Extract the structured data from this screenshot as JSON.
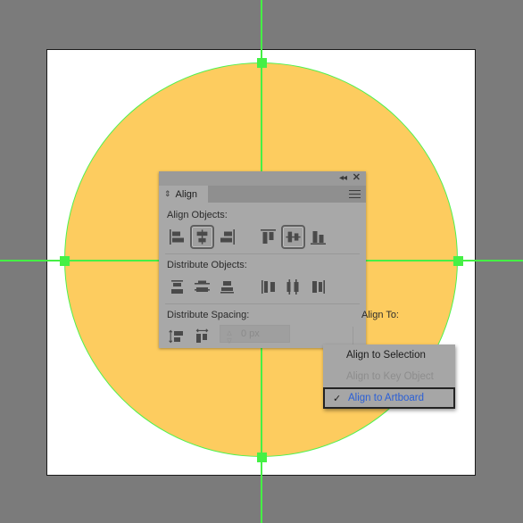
{
  "app": {
    "canvas_background": "#7b7b7b",
    "artboard_background": "#ffffff",
    "shape_fill": "#fdcc5f",
    "shape_stroke": "#4ff24f",
    "guide_color": "#45f045"
  },
  "panel": {
    "tab_label": "Align",
    "tab_toggle_icon": "⇕",
    "collapse_icon": "◂◂",
    "close_icon": "✕",
    "menu_icon": "hamburger-icon",
    "sections": {
      "align_objects_label": "Align Objects:",
      "distribute_objects_label": "Distribute Objects:",
      "distribute_spacing_label": "Distribute Spacing:",
      "align_to_label": "Align To:"
    },
    "align_objects_buttons": [
      {
        "name": "horizontal-align-left",
        "selected": false
      },
      {
        "name": "horizontal-align-center",
        "selected": true
      },
      {
        "name": "horizontal-align-right",
        "selected": false
      },
      {
        "name": "vertical-align-top",
        "selected": false
      },
      {
        "name": "vertical-align-center",
        "selected": true
      },
      {
        "name": "vertical-align-bottom",
        "selected": false
      }
    ],
    "distribute_objects_buttons": [
      {
        "name": "vertical-distribute-top",
        "selected": false
      },
      {
        "name": "vertical-distribute-center",
        "selected": false
      },
      {
        "name": "vertical-distribute-bottom",
        "selected": false
      },
      {
        "name": "horizontal-distribute-left",
        "selected": false
      },
      {
        "name": "horizontal-distribute-center",
        "selected": false
      },
      {
        "name": "horizontal-distribute-right",
        "selected": false
      }
    ],
    "distribute_spacing_buttons": [
      {
        "name": "vertical-distribute-spacing",
        "selected": false
      },
      {
        "name": "horizontal-distribute-spacing",
        "selected": false
      }
    ],
    "spacing_value": "0 px",
    "spacing_placeholder": "0 px",
    "stepper_up_icon": "△",
    "stepper_down_icon": "▽",
    "align_to_button_icon": "artboard-icon",
    "align_to_chevron": "⌄"
  },
  "dropdown": {
    "items": [
      {
        "label": "Align to Selection",
        "checked": false,
        "disabled": false
      },
      {
        "label": "Align to Key Object",
        "checked": false,
        "disabled": true
      },
      {
        "label": "Align to Artboard",
        "checked": true,
        "disabled": false
      }
    ],
    "check_glyph": "✓"
  }
}
